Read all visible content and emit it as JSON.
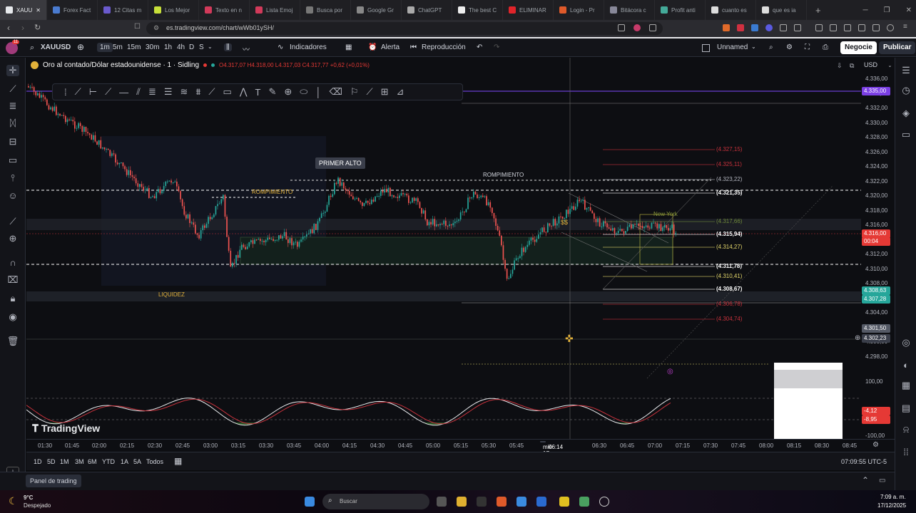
{
  "browser": {
    "tabs": [
      {
        "label": "XAUU",
        "color": "#e8eaed",
        "active": true
      },
      {
        "label": "Forex Fact",
        "color": "#4a7bd0"
      },
      {
        "label": "12 Citas m",
        "color": "#6a5acd"
      },
      {
        "label": "Los Mejor",
        "color": "#c8e03a"
      },
      {
        "label": "Texto en n",
        "color": "#d23a5a"
      },
      {
        "label": "Lista Emoj",
        "color": "#d23a5a"
      },
      {
        "label": "Busca por",
        "color": "#777"
      },
      {
        "label": "Google Gr",
        "color": "#888"
      },
      {
        "label": "ChatGPT",
        "color": "#aaa"
      },
      {
        "label": "The best C",
        "color": "#eee"
      },
      {
        "label": "ELIMINAR",
        "color": "#e0242a"
      },
      {
        "label": "Login - Pr",
        "color": "#e05a2a"
      },
      {
        "label": "Bitácora c",
        "color": "#889"
      },
      {
        "label": "Profit anti",
        "color": "#4a9"
      },
      {
        "label": "cuanto es",
        "color": "#ddd"
      },
      {
        "label": "que es ia",
        "color": "#ddd"
      }
    ],
    "new_tab": "+",
    "url": "es.tradingview.com/chart/wWb01ySH/"
  },
  "toolbar": {
    "notif_count": "11",
    "symbol": "XAUUSD",
    "intervals": [
      "1m",
      "5m",
      "15m",
      "30m",
      "1h",
      "4h",
      "D",
      "S"
    ],
    "active_interval": "1m",
    "indicators": "Indicadores",
    "alert": "Alerta",
    "replay": "Reproducción",
    "layout_name": "Unnamed",
    "trade_button": "Negocie",
    "publish_button": "Publicar"
  },
  "legend": {
    "title": "Oro al contado/Dólar estadounidense · 1 · Sidling",
    "ohlc": "O4.317,07 H4.318,00 L4.317,03 C4.317,77 +0,62 (+0,01%)",
    "currency": "USD"
  },
  "annotations": {
    "primer_alto": "PRIMER ALTO",
    "rompimiento_left": "ROMPIMIENTO",
    "rompimiento_right": "ROMPIMIENTO",
    "liquidez": "LIQUIDEZ",
    "new_york": "New York",
    "dollar_marker": "$$"
  },
  "fib_levels": [
    {
      "label": "(4.327,15)",
      "color": "#c8323c"
    },
    {
      "label": "(4.325,11)",
      "color": "#c8323c"
    },
    {
      "label": "(4.323,22)",
      "color": "#b2b5be"
    },
    {
      "label": "(4.321,35)",
      "color": "#ffffff"
    },
    {
      "label": "(4.317,66)",
      "color": "#6f8a3a"
    },
    {
      "label": "(4.315,94)",
      "color": "#ffffff"
    },
    {
      "label": "(4.314,27)",
      "color": "#e3d66a"
    },
    {
      "label": "(4.311,78)",
      "color": "#ffffff"
    },
    {
      "label": "(4.310,41)",
      "color": "#e3d66a"
    },
    {
      "label": "(4.308,67)",
      "color": "#ffffff"
    },
    {
      "label": "(4.306,78)",
      "color": "#c8323c"
    },
    {
      "label": "(4.304,74)",
      "color": "#c8323c"
    }
  ],
  "price_axis": {
    "ticks": [
      "4.336,00",
      "4.334,00",
      "4.332,00",
      "4.330,00",
      "4.328,00",
      "4.326,00",
      "4.324,00",
      "4.322,00",
      "4.320,00",
      "4.318,00",
      "4.316,00",
      "4.314,00",
      "4.312,00",
      "4.310,00",
      "4.308,00",
      "4.306,00",
      "4.304,00",
      "4.302,00",
      "4.300,00",
      "4.298,00"
    ],
    "labels": [
      {
        "text": "4.335,00",
        "color": "#7b3fe4"
      },
      {
        "text": "4.316,00",
        "color": "#e53935"
      },
      {
        "text": "00:04",
        "color": "#e53935"
      },
      {
        "text": "4.308,63",
        "color": "#26a69a"
      },
      {
        "text": "4.307,28",
        "color": "#26a69a"
      },
      {
        "text": "4.301,50",
        "color": "#555a66"
      },
      {
        "text": "4.302,23",
        "color": "#3a3e4a"
      }
    ],
    "osc_ticks": [
      "100,00",
      "-100,00"
    ],
    "osc_labels": [
      {
        "text": "-4,12",
        "color": "#e53935"
      },
      {
        "text": "-8,95",
        "color": "#e53935"
      }
    ]
  },
  "time_axis": {
    "ticks": [
      "01:30",
      "01:45",
      "02:00",
      "02:15",
      "02:30",
      "02:45",
      "03:00",
      "03:15",
      "03:30",
      "03:45",
      "04:00",
      "04:15",
      "04:30",
      "04:45",
      "05:00",
      "05:15",
      "05:30",
      "05:45",
      "06:30",
      "06:45",
      "07:00",
      "07:15",
      "07:30",
      "07:45",
      "08:00",
      "08:15",
      "08:30",
      "08:45"
    ],
    "cursor_label": "mié 17 Dic '25",
    "cursor_time": "06:14"
  },
  "ranges": [
    "1D",
    "5D",
    "1M",
    "3M",
    "6M",
    "YTD",
    "1A",
    "5A",
    "Todos"
  ],
  "clock": "07:09:55 UTC-5",
  "panel": {
    "label": "Panel de trading"
  },
  "watermark": "TradingView",
  "taskbar": {
    "weather_temp": "9°C",
    "weather_desc": "Despejado",
    "search_placeholder": "Buscar",
    "time": "7:09 a. m.",
    "date": "17/12/2025"
  }
}
